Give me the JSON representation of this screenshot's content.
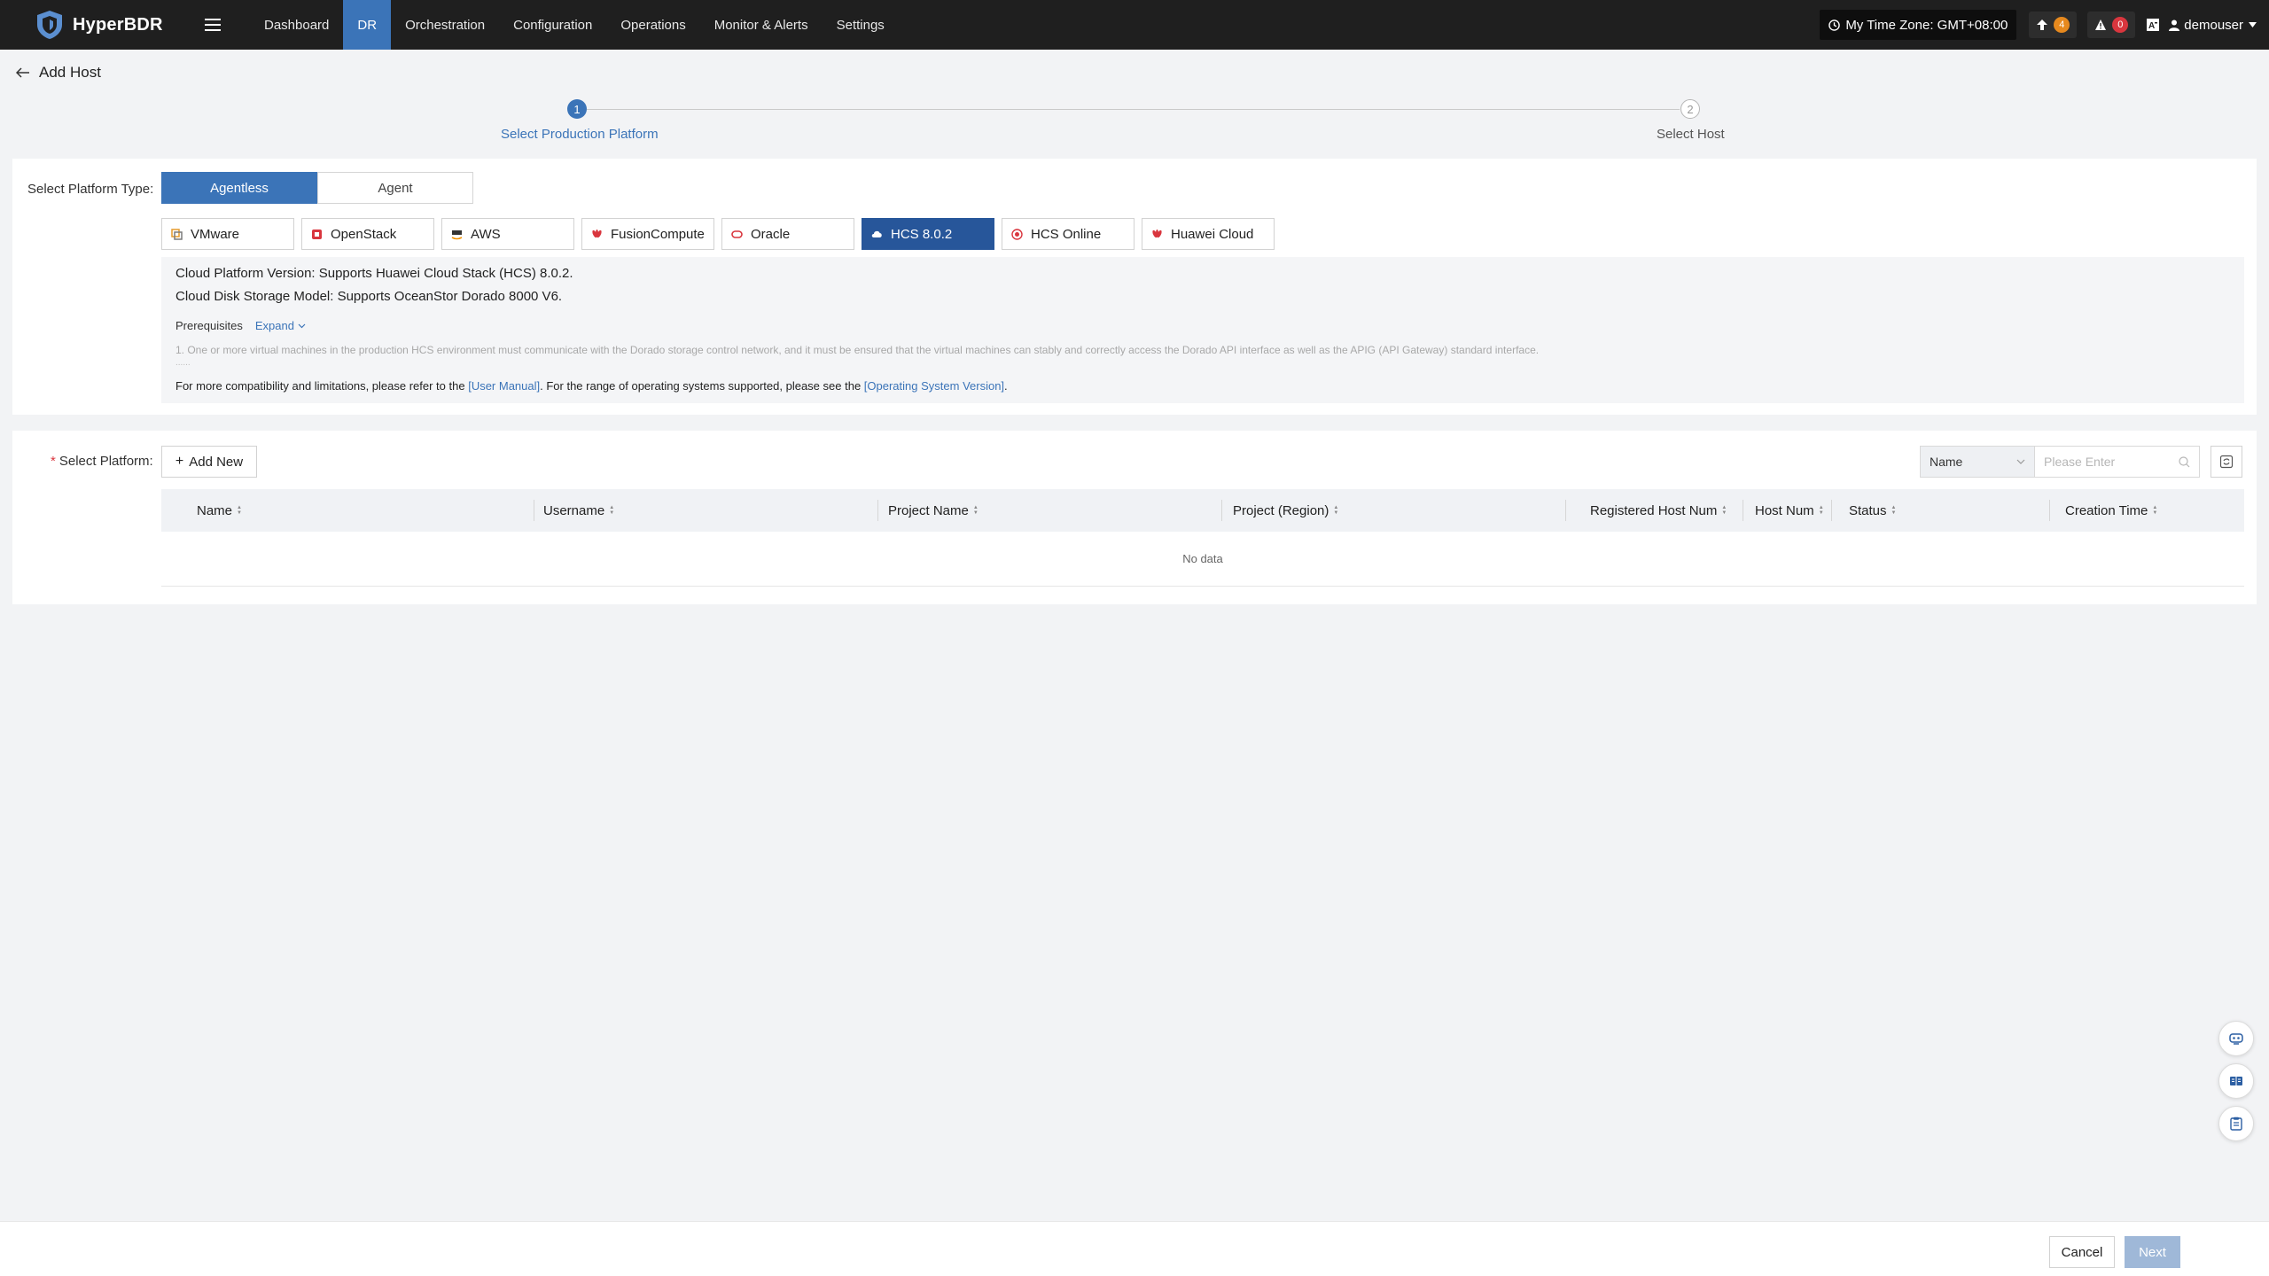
{
  "app": {
    "name": "HyperBDR"
  },
  "nav": {
    "items": [
      {
        "label": "Dashboard",
        "active": false
      },
      {
        "label": "DR",
        "active": true
      },
      {
        "label": "Orchestration",
        "active": false
      },
      {
        "label": "Configuration",
        "active": false
      },
      {
        "label": "Operations",
        "active": false
      },
      {
        "label": "Monitor & Alerts",
        "active": false
      },
      {
        "label": "Settings",
        "active": false
      }
    ]
  },
  "header_right": {
    "timezone": "My Time Zone: GMT+08:00",
    "upload_count": "4",
    "alert_count": "0",
    "username": "demouser"
  },
  "page": {
    "title": "Add Host"
  },
  "steps": [
    {
      "number": "1",
      "label": "Select Production Platform",
      "active": true
    },
    {
      "number": "2",
      "label": "Select Host",
      "active": false
    }
  ],
  "platform_type": {
    "label": "Select Platform Type:",
    "options": [
      "Agentless",
      "Agent"
    ],
    "selected": "Agentless"
  },
  "platforms": [
    {
      "label": "VMware",
      "icon": "vmware-icon",
      "color": "#e59a2b",
      "active": false
    },
    {
      "label": "OpenStack",
      "icon": "openstack-icon",
      "color": "#d9363e",
      "active": false
    },
    {
      "label": "AWS",
      "icon": "aws-icon",
      "color": "#f29100",
      "active": false
    },
    {
      "label": "FusionCompute",
      "icon": "huawei-icon",
      "color": "#d9363e",
      "active": false
    },
    {
      "label": "Oracle",
      "icon": "oracle-icon",
      "color": "#d9363e",
      "active": false
    },
    {
      "label": "HCS 8.0.2",
      "icon": "cloud-icon",
      "color": "#ffffff",
      "active": true
    },
    {
      "label": "HCS Online",
      "icon": "hcs-online-icon",
      "color": "#d9363e",
      "active": false
    },
    {
      "label": "Huawei Cloud",
      "icon": "huawei-icon",
      "color": "#d9363e",
      "active": false
    }
  ],
  "info": {
    "version_line": "Cloud Platform Version: Supports Huawei Cloud Stack (HCS) 8.0.2.",
    "storage_line": "Cloud Disk Storage Model: Supports OceanStor Dorado 8000 V6.",
    "prereq_label": "Prerequisites",
    "expand_label": "Expand",
    "prereq_note": "1. One or more virtual machines in the production HCS environment must communicate with the Dorado storage control network, and it must be ensured that the virtual machines can stably and correctly access the Dorado API interface as well as the APIG (API Gateway) standard interface.",
    "ellipsis": "......",
    "ref_prefix": "For more compatibility and limitations, please refer to the ",
    "ref_manual": "[User Manual]",
    "ref_middle": ". For the range of operating systems supported, please see the ",
    "ref_os": "[Operating System Version]",
    "ref_suffix": "."
  },
  "select_platform": {
    "label": "Select Platform:",
    "add_new": "Add New",
    "filter_field": "Name",
    "search_placeholder": "Please Enter"
  },
  "table": {
    "columns": [
      "Name",
      "Username",
      "Project Name",
      "Project (Region)",
      "Registered Host Num",
      "Host Num",
      "Status",
      "Creation Time"
    ],
    "empty_text": "No data"
  },
  "footer": {
    "cancel": "Cancel",
    "next": "Next"
  },
  "colors": {
    "accent": "#3b74b8",
    "active_platform": "#27569a",
    "topbar": "#1f1f1f"
  }
}
